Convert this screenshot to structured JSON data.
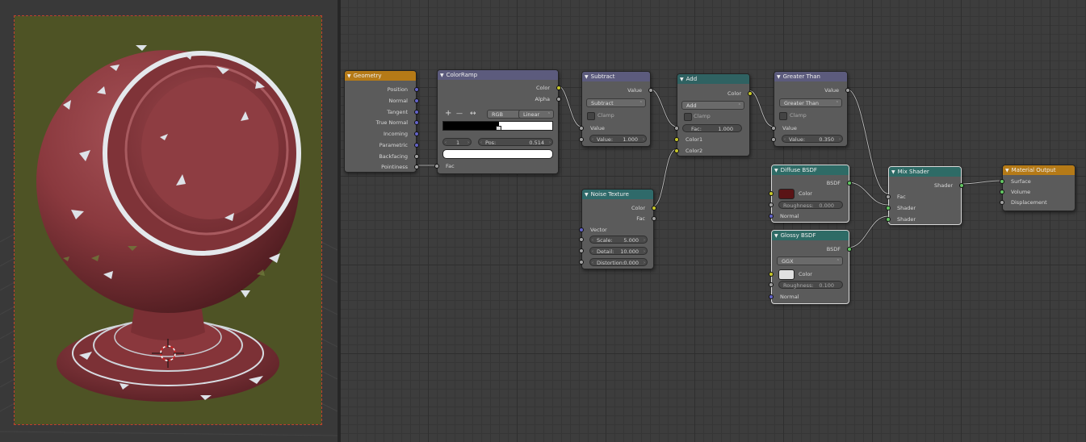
{
  "viewport": {
    "background": "#393939",
    "render_background": "#4e5325",
    "material_color": "#8c3a3e",
    "highlight_color": "#dfe4ea",
    "border_color": "#c04030"
  },
  "editor": {
    "background": "#3d3d3d"
  },
  "icons": {
    "collapse": "▼",
    "add": "+",
    "remove": "—",
    "flip": "↔",
    "left_arrow": "‹",
    "right_arrow": "›",
    "chevron": "⌃"
  },
  "nodes": {
    "geometry": {
      "title": "Geometry",
      "outputs": [
        "Position",
        "Normal",
        "Tangent",
        "True Normal",
        "Incoming",
        "Parametric",
        "Backfacing",
        "Pointiness"
      ]
    },
    "colorramp": {
      "title": "ColorRamp",
      "outputs": [
        "Color",
        "Alpha"
      ],
      "color_mode": "RGB",
      "interpolation": "Linear",
      "stop_index": "1",
      "pos_label": "Pos:",
      "pos_value": "0.514",
      "input": "Fac",
      "stop_position": 0.514
    },
    "subtract": {
      "title": "Subtract",
      "output": "Value",
      "operation": "Subtract",
      "clamp_label": "Clamp",
      "input_label": "Value",
      "value_label": "Value:",
      "value": "1.000"
    },
    "add": {
      "title": "Add",
      "output": "Color",
      "blend_type": "Add",
      "clamp_label": "Clamp",
      "fac_label": "Fac:",
      "fac_value": "1.000",
      "inputs": [
        "Color1",
        "Color2"
      ]
    },
    "greater_than": {
      "title": "Greater Than",
      "output": "Value",
      "operation": "Greater Than",
      "clamp_label": "Clamp",
      "input_label": "Value",
      "value_label": "Value:",
      "value": "0.350"
    },
    "noise_texture": {
      "title": "Noise Texture",
      "outputs": [
        "Color",
        "Fac"
      ],
      "input": "Vector",
      "fields": [
        {
          "label": "Scale:",
          "value": "5.000"
        },
        {
          "label": "Detail:",
          "value": "10.000"
        },
        {
          "label": "Distortion:",
          "value": "0.000"
        }
      ]
    },
    "diffuse": {
      "title": "Diffuse BSDF",
      "output": "BSDF",
      "color_label": "Color",
      "color": "#5a1416",
      "roughness_label": "Roughness:",
      "roughness": "0.000",
      "normal_label": "Normal"
    },
    "glossy": {
      "title": "Glossy BSDF",
      "output": "BSDF",
      "distribution": "GGX",
      "color_label": "Color",
      "color": "#e0e0e0",
      "roughness_label": "Roughness:",
      "roughness": "0.100",
      "normal_label": "Normal"
    },
    "mix_shader": {
      "title": "Mix Shader",
      "output": "Shader",
      "inputs": [
        "Fac",
        "Shader",
        "Shader"
      ]
    },
    "material_output": {
      "title": "Material Output",
      "inputs": [
        "Surface",
        "Volume",
        "Displacement"
      ]
    }
  }
}
